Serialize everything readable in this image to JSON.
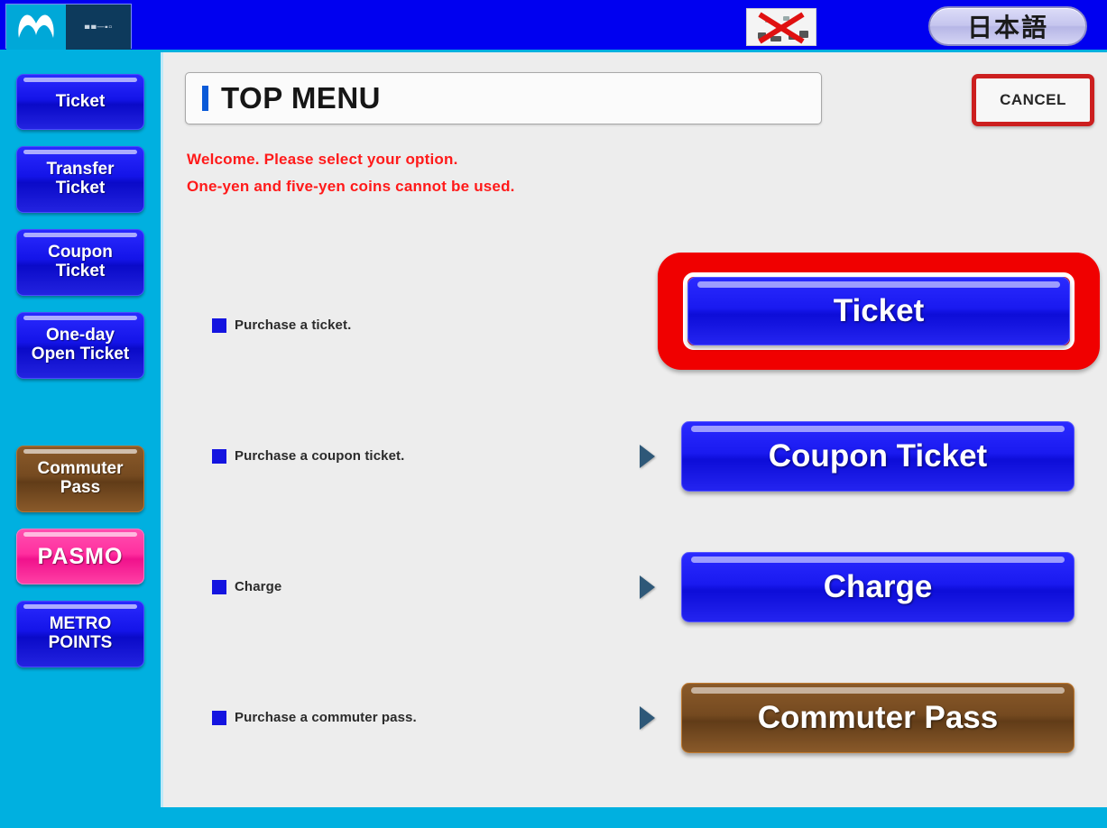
{
  "topbar": {
    "logo_icon": "tokyo-metro-m-logo",
    "logo_panel_text": "■■─▪▫",
    "broken_image_icon": "broken-image-red-x",
    "language_button": "日本語"
  },
  "sidebar": {
    "items": [
      {
        "label": "Ticket",
        "color": "#1414e8",
        "style": "blue",
        "lines": 1
      },
      {
        "label": "Transfer\nTicket",
        "color": "#1414e8",
        "style": "blue",
        "lines": 2
      },
      {
        "label": "Coupon\nTicket",
        "color": "#1414e8",
        "style": "blue",
        "lines": 2
      },
      {
        "label": "One-day\nOpen Ticket",
        "color": "#1414e8",
        "style": "blue",
        "lines": 2
      },
      {
        "label": "Commuter\nPass",
        "color": "#754a20",
        "style": "brown",
        "lines": 2
      },
      {
        "label": "PASMO",
        "color": "#ff2f9f",
        "style": "pink",
        "lines": 1
      },
      {
        "label": "METRO\nPOINTS",
        "color": "#1414e8",
        "style": "blue",
        "lines": 2
      }
    ]
  },
  "header": {
    "title": "TOP MENU",
    "accent_color": "#0a5ad8",
    "cancel_label": "CANCEL",
    "cancel_border_color": "#cc1f1f"
  },
  "notice": {
    "line1": "Welcome. Please select your option.",
    "line2": "One-yen and five-yen coins cannot be used.",
    "color": "#ff1a1a"
  },
  "menu": {
    "rows": [
      {
        "description": "Purchase a ticket.",
        "button_label": "Ticket",
        "button_style": "blue",
        "button_color": "#1a1af0",
        "highlighted": true,
        "highlight_color": "#f00000",
        "has_arrow": false
      },
      {
        "description": "Purchase a coupon ticket.",
        "button_label": "Coupon Ticket",
        "button_style": "blue",
        "button_color": "#1a1af0",
        "highlighted": false,
        "has_arrow": true
      },
      {
        "description": "Charge",
        "button_label": "Charge",
        "button_style": "blue",
        "button_color": "#1a1af0",
        "highlighted": false,
        "has_arrow": true
      },
      {
        "description": "Purchase a commuter pass.",
        "button_label": "Commuter Pass",
        "button_style": "brown",
        "button_color": "#754a20",
        "highlighted": false,
        "has_arrow": true
      }
    ]
  },
  "theme": {
    "topbar_blue": "#0000f0",
    "sidebar_cyan": "#00b0e0",
    "content_gray": "#ededed"
  }
}
